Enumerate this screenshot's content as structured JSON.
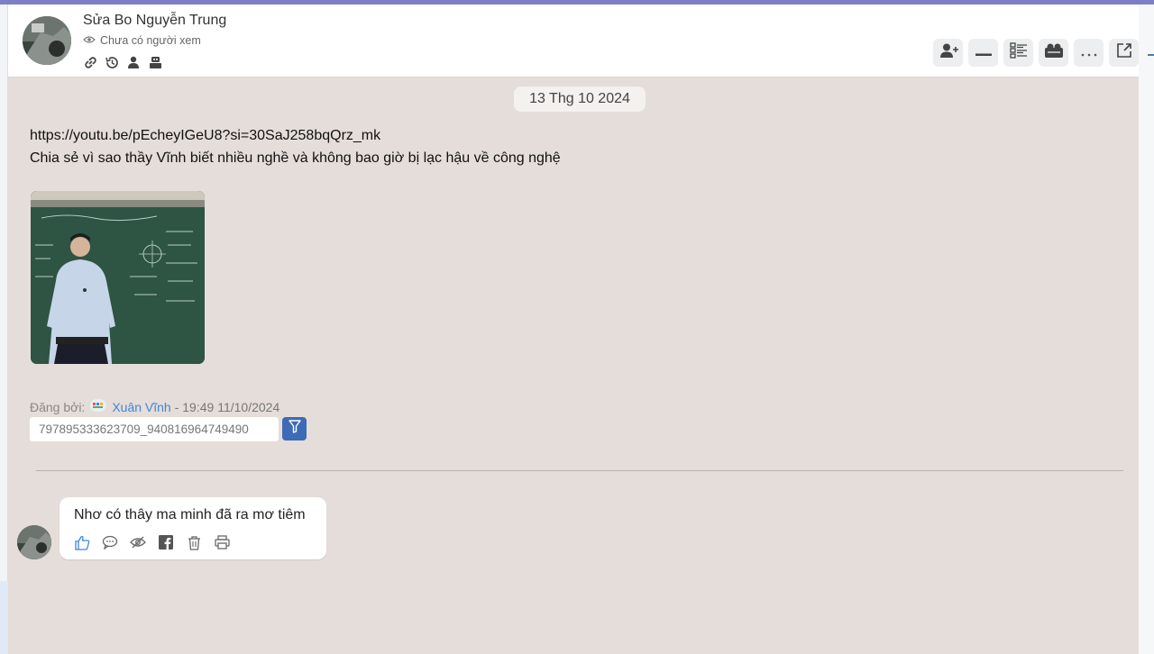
{
  "header": {
    "title": "Sửa Bo Nguyễn Trung",
    "viewers": "Chưa có người xem"
  },
  "chat": {
    "date": "13 Thg 10 2024",
    "message": {
      "link": "https://youtu.be/pEcheyIGeU8?si=30SaJ258bqQrz_mk",
      "text": "Chia sẻ vì sao thầy Vĩnh biết nhiều nghề và không bao giờ bị lạc hậu về công nghệ",
      "posted_by_label": "Đăng bởi:",
      "author": "Xuân Vĩnh",
      "time": "- 19:49 11/10/2024",
      "id": "797895333623709_940816964749490"
    },
    "comment": {
      "text": "Nhơ có thây ma minh đã ra mơ tiêm"
    }
  },
  "colors": {
    "accent": "#3d6bb5",
    "chat_bg": "#e5ddd9",
    "link": "#3f87d6"
  }
}
